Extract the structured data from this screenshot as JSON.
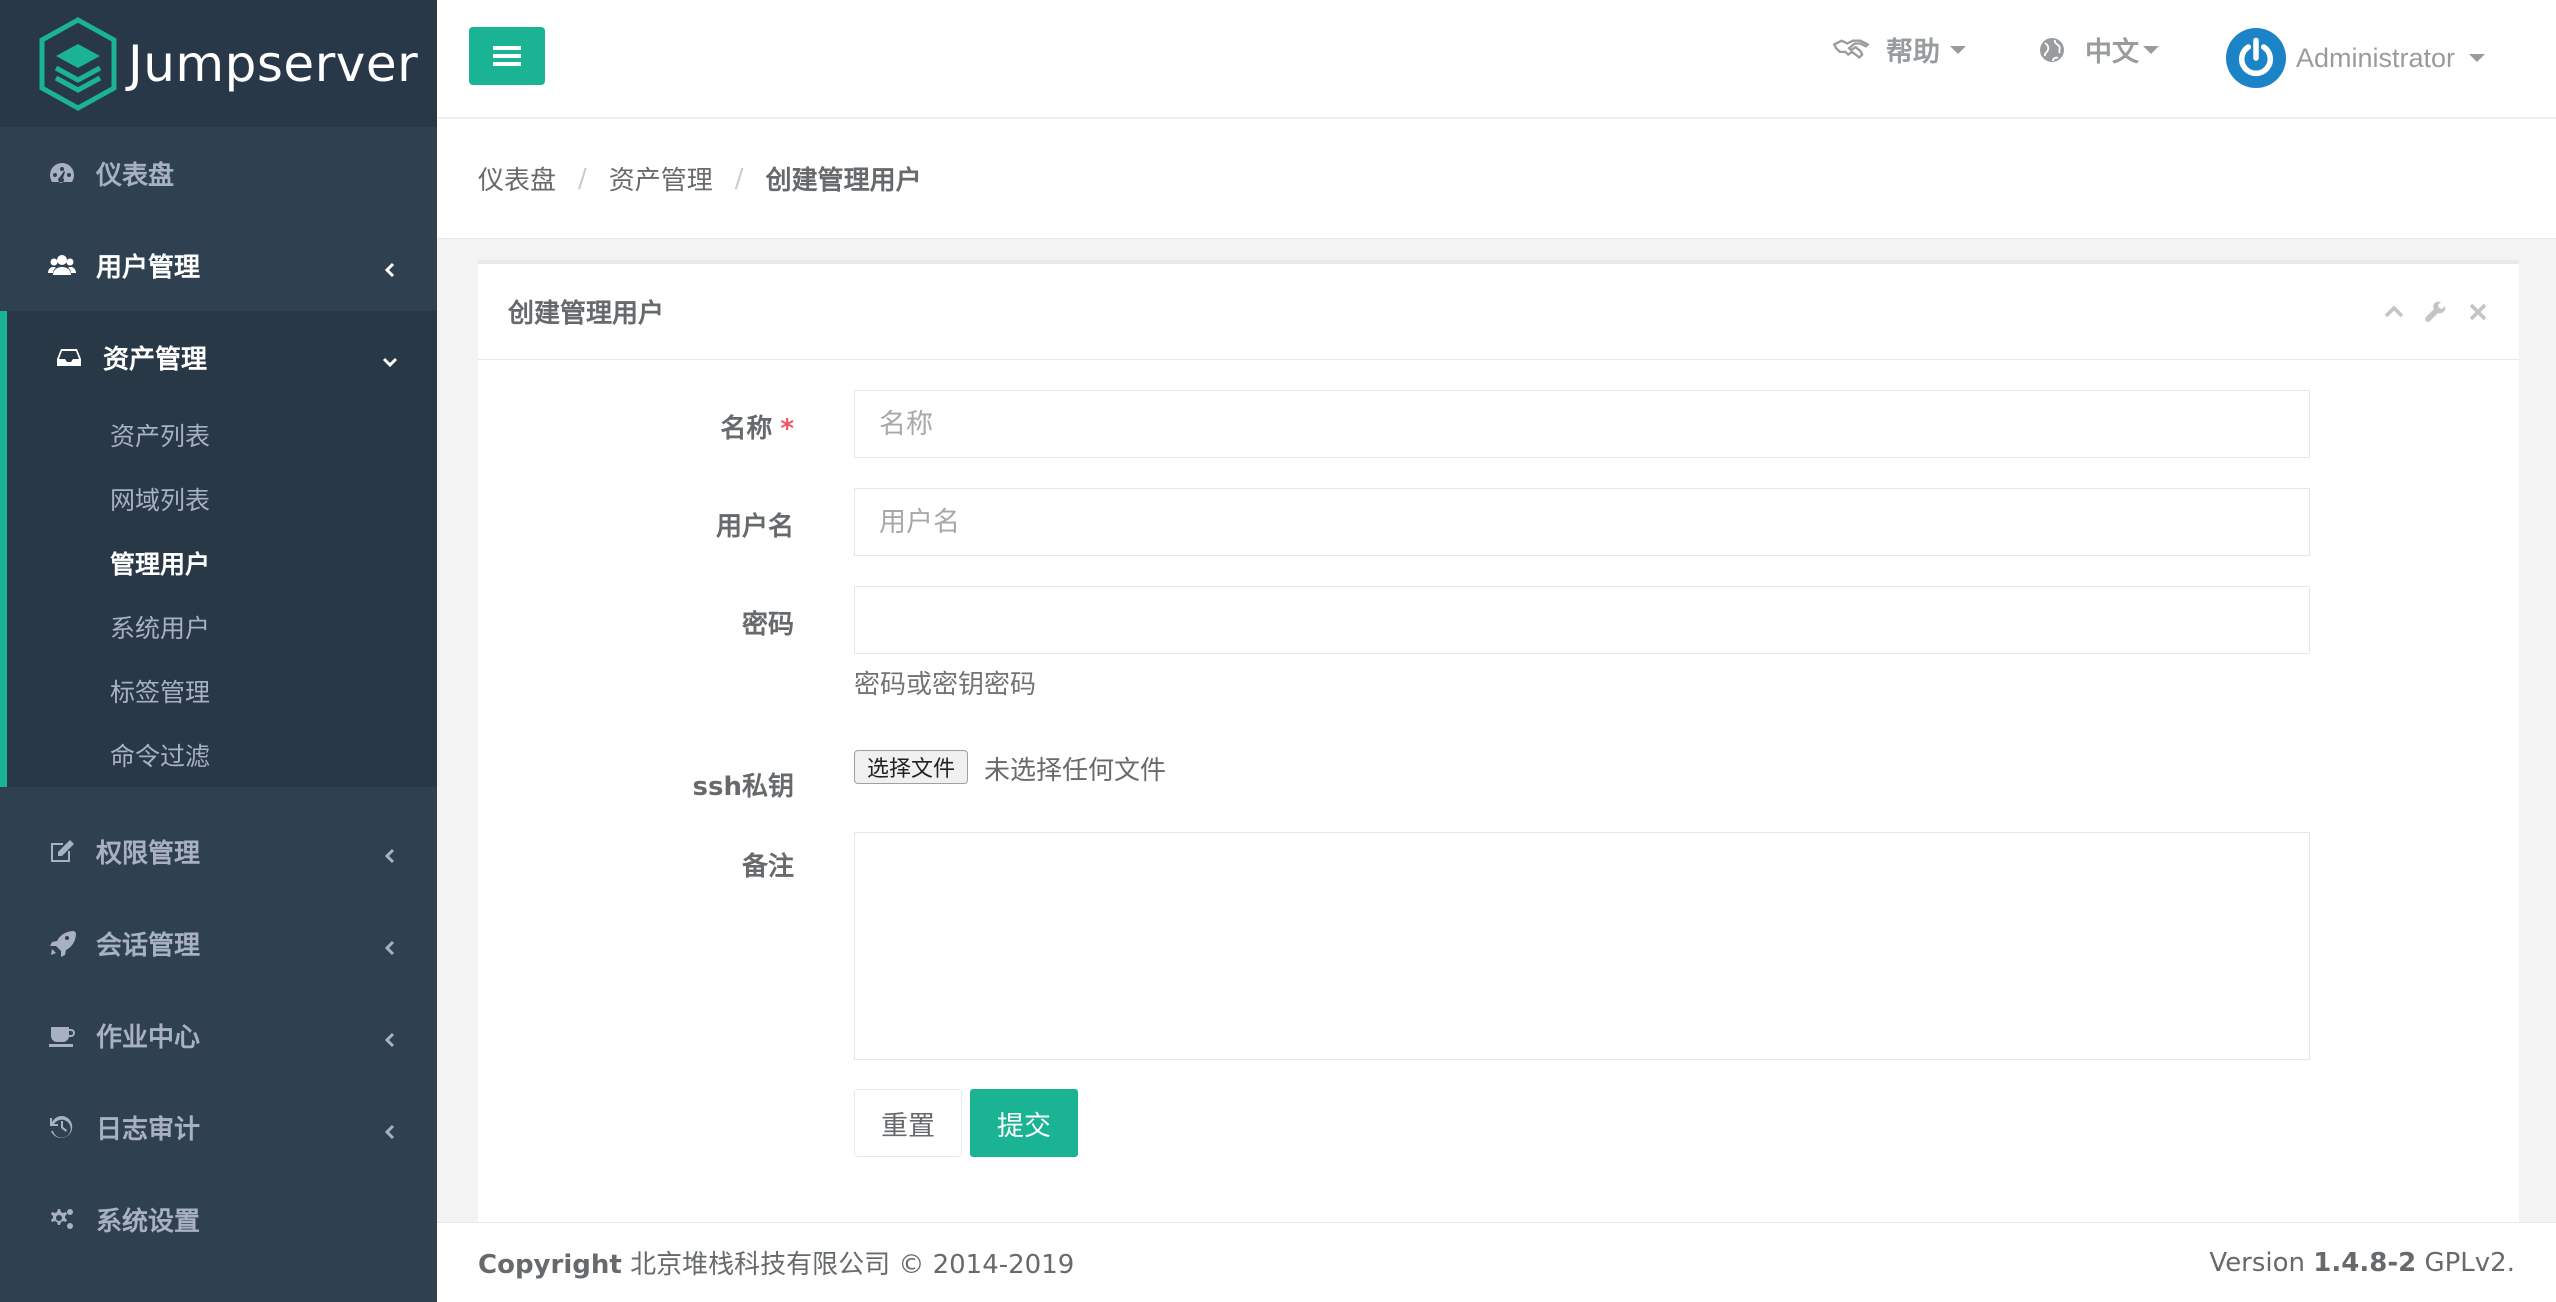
{
  "brand": {
    "name": "Jumpserver"
  },
  "sidebar": {
    "items": [
      {
        "label": "仪表盘",
        "icon": "dashboard-icon"
      },
      {
        "label": "用户管理",
        "icon": "users-icon"
      },
      {
        "label": "资产管理",
        "icon": "inbox-icon"
      },
      {
        "label": "权限管理",
        "icon": "edit-icon"
      },
      {
        "label": "会话管理",
        "icon": "rocket-icon"
      },
      {
        "label": "作业中心",
        "icon": "coffee-icon"
      },
      {
        "label": "日志审计",
        "icon": "history-icon"
      },
      {
        "label": "系统设置",
        "icon": "gears-icon"
      }
    ],
    "subitems": [
      {
        "label": "资产列表"
      },
      {
        "label": "网域列表"
      },
      {
        "label": "管理用户"
      },
      {
        "label": "系统用户"
      },
      {
        "label": "标签管理"
      },
      {
        "label": "命令过滤"
      }
    ]
  },
  "topbar": {
    "help": "帮助",
    "language": "中文",
    "user": "Administrator"
  },
  "breadcrumb": {
    "items": [
      "仪表盘",
      "资产管理",
      "创建管理用户"
    ]
  },
  "panel": {
    "title": "创建管理用户"
  },
  "form": {
    "name_label": "名称",
    "name_required": "*",
    "name_placeholder": "名称",
    "username_label": "用户名",
    "username_placeholder": "用户名",
    "password_label": "密码",
    "password_help": "密码或密钥密码",
    "ssh_label": "ssh私钥",
    "file_button": "选择文件",
    "file_status": "未选择任何文件",
    "comment_label": "备注",
    "reset_button": "重置",
    "submit_button": "提交"
  },
  "footer": {
    "copyright_label": "Copyright",
    "copyright_text": "北京堆栈科技有限公司 © 2014-2019",
    "version_label": "Version",
    "version_number": "1.4.8-2",
    "license": "GPLv2."
  },
  "colors": {
    "accent": "#1ab394",
    "sidebar": "#2f4050",
    "required": "#ed5565"
  }
}
